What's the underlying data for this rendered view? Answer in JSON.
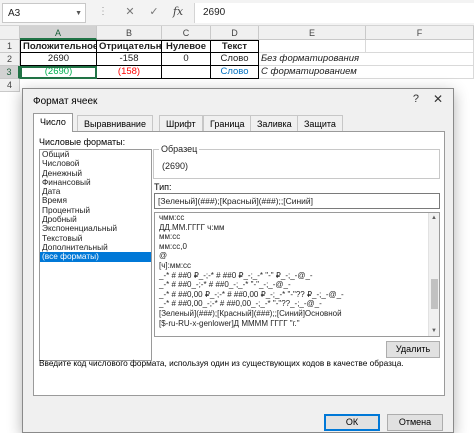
{
  "formula_bar": {
    "name_box": "A3",
    "cancel_glyph": "✕",
    "enter_glyph": "✓",
    "fx_label": "fx",
    "formula": "2690"
  },
  "grid": {
    "columns": [
      "A",
      "B",
      "C",
      "D",
      "E",
      "F"
    ],
    "rows": [
      "1",
      "2",
      "3",
      "4"
    ],
    "row1": [
      "Положительное",
      "Отрицательное",
      "Нулевое",
      "Текст"
    ],
    "row2": [
      "2690",
      "-158",
      "0",
      "Слово",
      "Без форматирования"
    ],
    "row3": [
      "(2690)",
      "(158)",
      "",
      "Слово",
      "С форматированием"
    ]
  },
  "colors": {
    "green": "#00b050",
    "red": "#ff0000",
    "blue": "#0070c0",
    "accent": "#217346",
    "selection": "#0078d7"
  },
  "dialog": {
    "title": "Формат ячеек",
    "help": "?",
    "close": "✕",
    "tabs": [
      "Число",
      "Выравнивание",
      "Шрифт",
      "Граница",
      "Заливка",
      "Защита"
    ],
    "categories_label": "Числовые форматы:",
    "categories": [
      "Общий",
      "Числовой",
      "Денежный",
      "Финансовый",
      "Дата",
      "Время",
      "Процентный",
      "Дробный",
      "Экспоненциальный",
      "Текстовый",
      "Дополнительный",
      "(все форматы)"
    ],
    "sample_label": "Образец",
    "sample_value": "(2690)",
    "type_label": "Тип:",
    "type_value": "[Зеленый](###);[Красный](###);;[Синий]",
    "formats": [
      "чмм:сс",
      "ДД.ММ.ГГГГ ч:мм",
      "мм:сс",
      "мм:сс,0",
      "@",
      "[ч]:мм:сс",
      "_-* # ##0 ₽_-;-* # ##0 ₽_-;_-* \"-\" ₽_-;_-@_-",
      "_-* # ##0_-;-* # ##0_-;_-* \"-\"_-;_-@_-",
      "_-* # ##0,00 ₽_-;-* # ##0,00 ₽_-;_-* \"-\"?? ₽_-;_-@_-",
      "_-* # ##0,00_-;-* # ##0,00_-;_-* \"-\"??_-;_-@_-",
      "[Зеленый](###);[Красный](###);;[Синий]Основной",
      "[$-ru-RU-x-genlower]Д ММММ ГГГГ \"г.\""
    ],
    "delete_button": "Удалить",
    "description": "Введите код числового формата, используя один из существующих кодов в качестве образца.",
    "ok_button": "ОК",
    "cancel_button": "Отмена"
  }
}
